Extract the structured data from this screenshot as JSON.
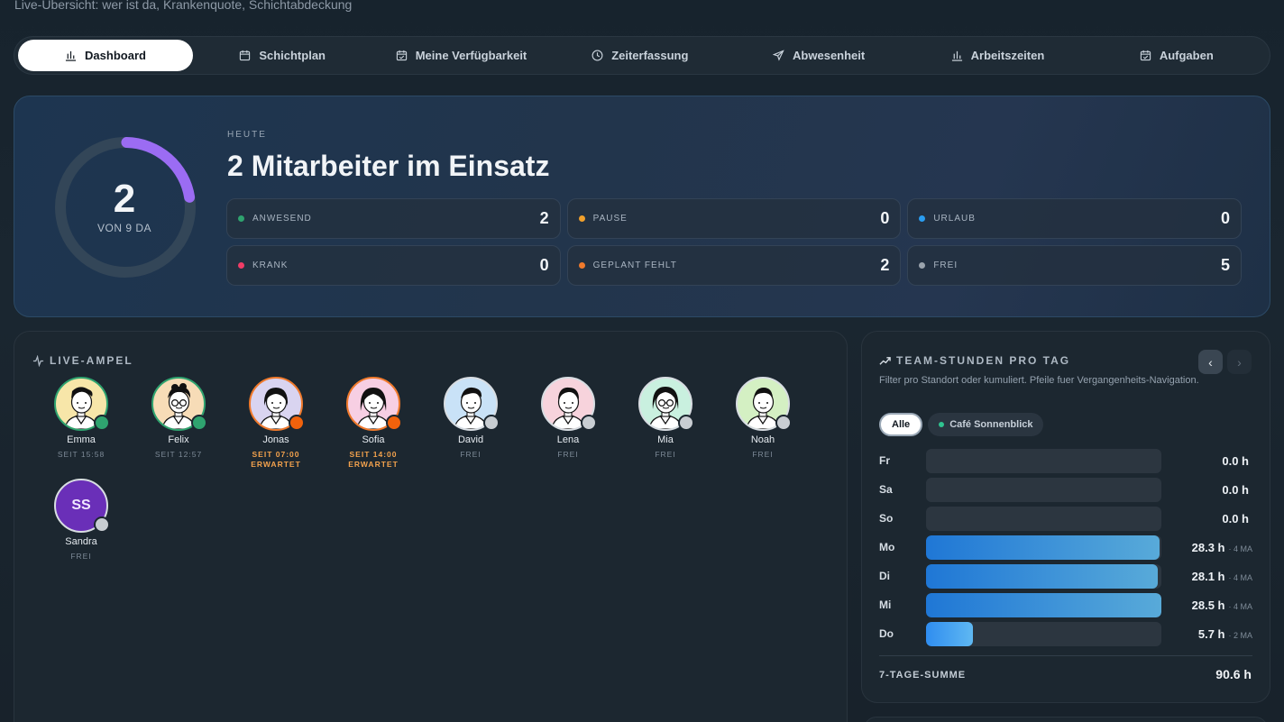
{
  "header": {
    "subtitle": "Live-Übersicht: wer ist da, Krankenquote, Schichtabdeckung"
  },
  "nav": [
    {
      "label": "Dashboard",
      "icon": "bar-chart-icon",
      "active": true
    },
    {
      "label": "Schichtplan",
      "icon": "calendar-icon"
    },
    {
      "label": "Meine Verfügbarkeit",
      "icon": "calendar-check-icon"
    },
    {
      "label": "Zeiterfassung",
      "icon": "clock-icon"
    },
    {
      "label": "Abwesenheit",
      "icon": "plane-icon"
    },
    {
      "label": "Arbeitszeiten",
      "icon": "bar-chart-icon"
    },
    {
      "label": "Aufgaben",
      "icon": "calendar-check-icon"
    }
  ],
  "hero": {
    "gauge_value": "2",
    "gauge_sub": "VON 9 DA",
    "gauge_fraction": 0.222,
    "eyebrow": "HEUTE",
    "title": "2 Mitarbeiter im Einsatz",
    "stats": [
      {
        "label": "ANWESEND",
        "value": "2",
        "color": "#2fa36f"
      },
      {
        "label": "PAUSE",
        "value": "0",
        "color": "#f0a02c"
      },
      {
        "label": "URLAUB",
        "value": "0",
        "color": "#2a9df0"
      },
      {
        "label": "KRANK",
        "value": "0",
        "color": "#f03c66"
      },
      {
        "label": "GEPLANT FEHLT",
        "value": "2",
        "color": "#f07a2c"
      },
      {
        "label": "FREI",
        "value": "5",
        "color": "#9aa3ad"
      }
    ]
  },
  "ampel": {
    "title": "LIVE-AMPEL",
    "people": [
      {
        "name": "Emma",
        "sub": "SEIT 15:58",
        "status": "present",
        "bg": "#f7e6a9",
        "ring": "#2fa36f",
        "dot": "#2fa36f",
        "warn": false
      },
      {
        "name": "Felix",
        "sub": "SEIT 12:57",
        "status": "present",
        "bg": "#f7dcb7",
        "ring": "#2fa36f",
        "dot": "#2fa36f",
        "warn": false
      },
      {
        "name": "Jonas",
        "sub": "SEIT 07:00 ERWARTET",
        "status": "missing",
        "bg": "#d9d4f0",
        "ring": "#f07a2c",
        "dot": "#f0620c",
        "warn": true
      },
      {
        "name": "Sofia",
        "sub": "SEIT 14:00 ERWARTET",
        "status": "missing",
        "bg": "#f7cfe3",
        "ring": "#f07a2c",
        "dot": "#f0620c",
        "warn": true
      },
      {
        "name": "David",
        "sub": "FREI",
        "status": "free",
        "bg": "#c9e2f7",
        "ring": "#d8dde2",
        "dot": "#c8cdd2",
        "warn": false
      },
      {
        "name": "Lena",
        "sub": "FREI",
        "status": "free",
        "bg": "#f7d3dc",
        "ring": "#d8dde2",
        "dot": "#c8cdd2",
        "warn": false
      },
      {
        "name": "Mia",
        "sub": "FREI",
        "status": "free",
        "bg": "#c9f0df",
        "ring": "#d8dde2",
        "dot": "#c8cdd2",
        "warn": false
      },
      {
        "name": "Noah",
        "sub": "FREI",
        "status": "free",
        "bg": "#d4f0c3",
        "ring": "#d8dde2",
        "dot": "#c8cdd2",
        "warn": false
      },
      {
        "name": "Sandra",
        "sub": "FREI",
        "status": "free",
        "initials": "SS",
        "bg": "#6a2fb8",
        "ring": "#d8dde2",
        "dot": "#c8cdd2",
        "warn": false
      }
    ]
  },
  "team": {
    "title": "TEAM-STUNDEN PRO TAG",
    "desc": "Filter pro Standort oder kumuliert. Pfeile fuer Vergangenheits-Navigation.",
    "prev": "‹",
    "next": "›",
    "filters": [
      {
        "label": "Alle",
        "active": true
      },
      {
        "label": "Café Sonnenblick",
        "active": false,
        "dot": "#2fc38f"
      }
    ],
    "rows": [
      {
        "day": "Fr",
        "hours": "0.0 h",
        "ma": "",
        "value": 0
      },
      {
        "day": "Sa",
        "hours": "0.0 h",
        "ma": "",
        "value": 0
      },
      {
        "day": "So",
        "hours": "0.0 h",
        "ma": "",
        "value": 0
      },
      {
        "day": "Mo",
        "hours": "28.3 h",
        "ma": "· 4 MA",
        "value": 28.3
      },
      {
        "day": "Di",
        "hours": "28.1 h",
        "ma": "· 4 MA",
        "value": 28.1
      },
      {
        "day": "Mi",
        "hours": "28.5 h",
        "ma": "· 4 MA",
        "value": 28.5
      },
      {
        "day": "Do",
        "hours": "5.7 h",
        "ma": "· 2 MA",
        "value": 5.7
      }
    ],
    "max_value": 28.5,
    "sum_label": "7-TAGE-SUMME",
    "sum_value": "90.6 h"
  }
}
